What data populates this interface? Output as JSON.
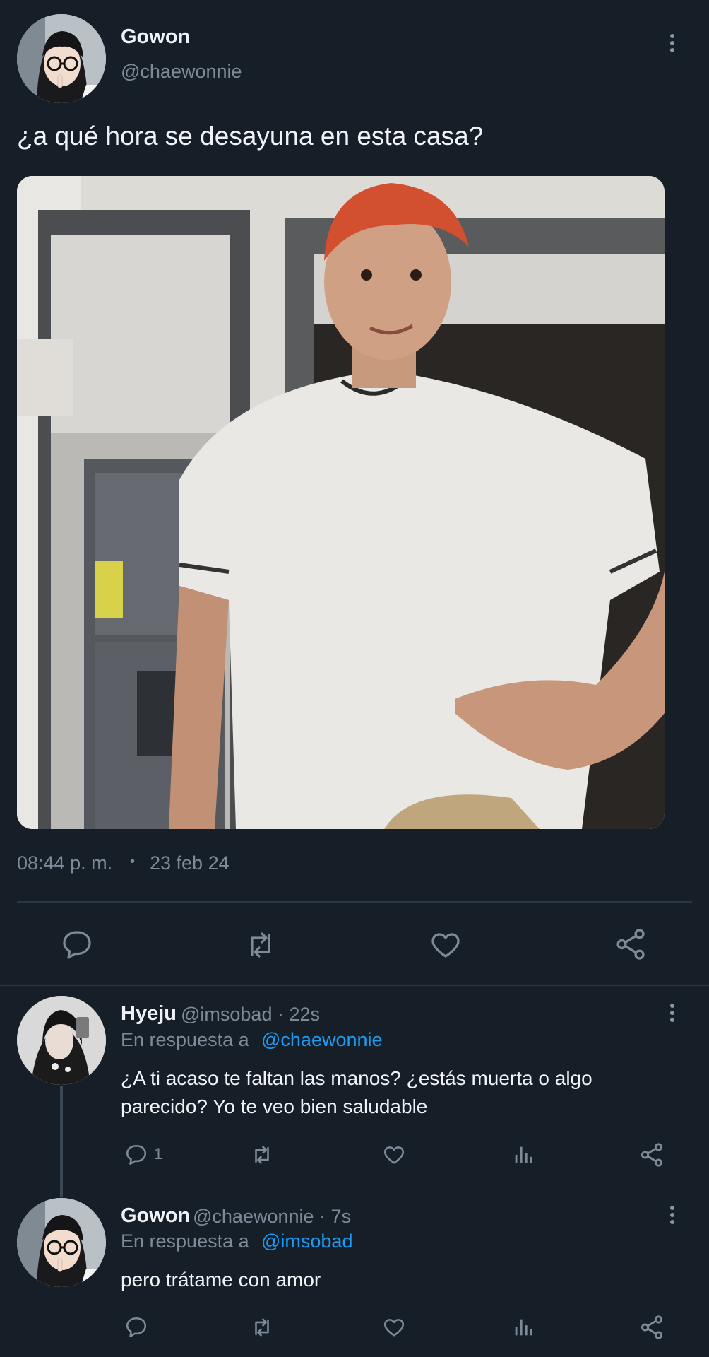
{
  "tweet": {
    "author_name": "Gowon",
    "author_handle": "@chaewonnie",
    "text": "¿a qué hora se desayuna en esta casa?",
    "time": "08:44 p. m.",
    "separator": "•",
    "date": "23 feb 24",
    "actions": [
      "reply-icon",
      "retweet-icon",
      "like-icon",
      "share-icon"
    ]
  },
  "replies": [
    {
      "author_name": "Hyeju",
      "meta": "@imsobad · 22s",
      "in_reply_prefix": "En respuesta a",
      "in_reply_handle": "@chaewonnie",
      "text_line1": "¿A ti acaso te faltan las manos? ¿estás muerta o algo",
      "text_line2": "parecido? Yo te veo bien saludable",
      "reply_count": "1"
    },
    {
      "author_name": "Gowon",
      "meta": "@chaewonnie · 7s",
      "in_reply_prefix": "En respuesta a",
      "in_reply_handle": "@imsobad",
      "text_line1": "pero trátame con amor"
    }
  ],
  "colors": {
    "background": "#161e28",
    "text": "#e8edf2",
    "muted": "#7d8b99",
    "link": "#1d9bf0",
    "divider": "#2b3642"
  }
}
